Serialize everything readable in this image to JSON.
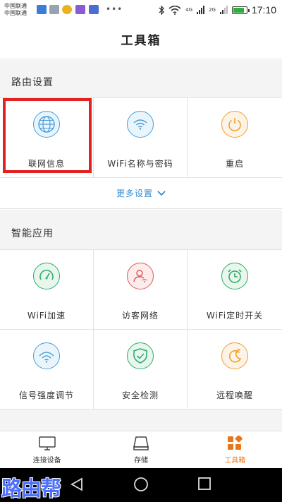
{
  "status_bar": {
    "carrier1": "中国联通",
    "carrier2": "中国联通",
    "network1": "4G",
    "network2": "2G",
    "time": "17:10",
    "battery_level": 0.85
  },
  "header": {
    "title": "工具箱"
  },
  "router_section": {
    "title": "路由设置",
    "items": [
      {
        "label": "联网信息",
        "icon": "globe-icon"
      },
      {
        "label": "WiFi名称与密码",
        "icon": "wifi-icon"
      },
      {
        "label": "重启",
        "icon": "power-icon"
      }
    ],
    "more_label": "更多设置"
  },
  "apps_section": {
    "title": "智能应用",
    "items": [
      {
        "label": "WiFi加速",
        "icon": "speedometer-icon"
      },
      {
        "label": "访客网络",
        "icon": "guest-user-icon"
      },
      {
        "label": "WiFi定时开关",
        "icon": "alarm-clock-icon"
      },
      {
        "label": "信号强度调节",
        "icon": "signal-strength-icon"
      },
      {
        "label": "安全检测",
        "icon": "shield-check-icon"
      },
      {
        "label": "远程唤醒",
        "icon": "moon-sleep-icon"
      }
    ]
  },
  "tabbar": {
    "tabs": [
      {
        "label": "连接设备",
        "icon": "monitor-icon"
      },
      {
        "label": "存储",
        "icon": "storage-icon"
      },
      {
        "label": "工具箱",
        "icon": "toolbox-icon",
        "active": true
      }
    ]
  },
  "watermark": "路由帮",
  "colors": {
    "accent_orange": "#e8761e",
    "link_blue": "#2f8fd8",
    "highlight_red": "#e12222",
    "icon_blue": "#4a9fd8",
    "icon_green": "#2eae6a",
    "icon_red": "#e05a5a",
    "icon_orange": "#f0a030"
  }
}
